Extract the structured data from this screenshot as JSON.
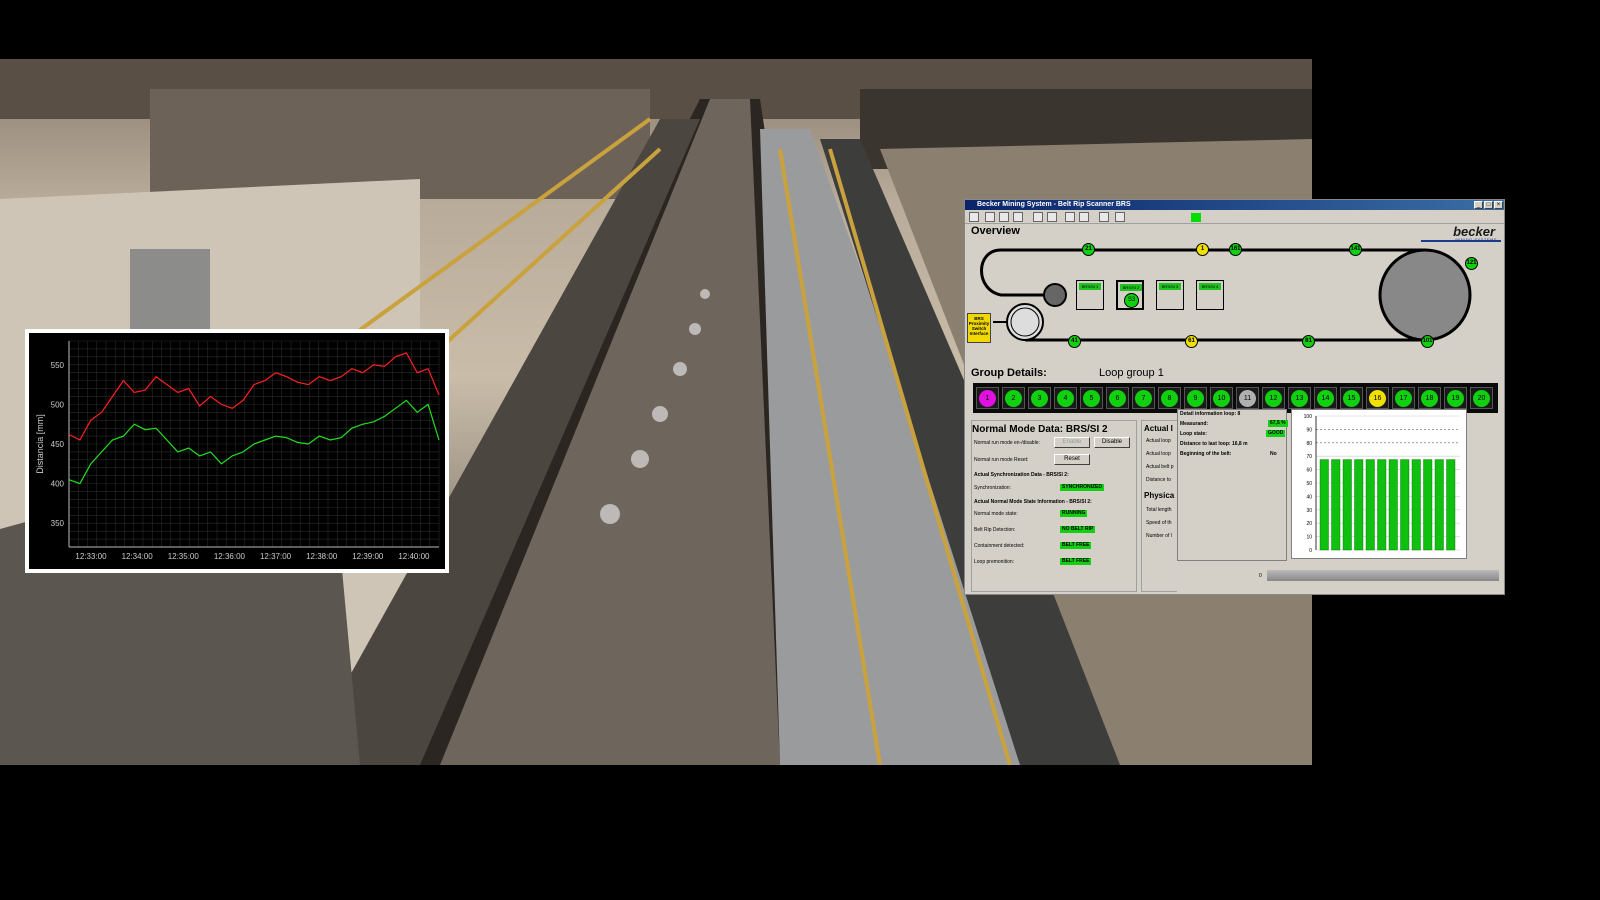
{
  "hmi": {
    "window_title": "Becker Mining System - Belt Rip Scanner BRS",
    "overview_title": "Overview",
    "logo_word": "becker",
    "logo_sub": "MINING SYSTEMS",
    "top_nodes": [
      "21",
      "1",
      "161",
      "141",
      "121"
    ],
    "top_node_colors": [
      "green",
      "yellow",
      "green",
      "green",
      "green"
    ],
    "bottom_nodes": [
      "41",
      "61",
      "81",
      "101"
    ],
    "bottom_node_colors": [
      "green",
      "yellow",
      "green",
      "green"
    ],
    "si_boxes": [
      "BRS/SI 1",
      "BRS/SI 2",
      "BRS/SI 3",
      "BRS/SI 4"
    ],
    "si_active_label": "S3",
    "prox_switch_label": "BRS Proximity Switch Interface",
    "group_details_title": "Group Details:",
    "loop_group_title": "Loop group 1",
    "loops": [
      {
        "n": "1",
        "state": "magenta"
      },
      {
        "n": "2",
        "state": "green"
      },
      {
        "n": "3",
        "state": "green"
      },
      {
        "n": "4",
        "state": "green"
      },
      {
        "n": "5",
        "state": "green"
      },
      {
        "n": "6",
        "state": "green"
      },
      {
        "n": "7",
        "state": "green"
      },
      {
        "n": "8",
        "state": "green"
      },
      {
        "n": "9",
        "state": "green"
      },
      {
        "n": "10",
        "state": "green"
      },
      {
        "n": "11",
        "state": "gray"
      },
      {
        "n": "12",
        "state": "green"
      },
      {
        "n": "13",
        "state": "green"
      },
      {
        "n": "14",
        "state": "green"
      },
      {
        "n": "15",
        "state": "green"
      },
      {
        "n": "16",
        "state": "yellow"
      },
      {
        "n": "17",
        "state": "green"
      },
      {
        "n": "18",
        "state": "green"
      },
      {
        "n": "19",
        "state": "green"
      },
      {
        "n": "20",
        "state": "green"
      }
    ],
    "normal_mode": {
      "title": "Normal Mode Data: BRS/SI 2",
      "run_mode_label": "Normal run mode en-/disable:",
      "enable_btn": "Enable",
      "disable_btn": "Disable",
      "reset_label": "Normal run mode Reset:",
      "reset_btn": "Reset",
      "sync_header": "Actual Synchronization Data - BRS/SI 2:",
      "sync_label": "Synchronization:",
      "sync_value": "SYNCHRONIZED",
      "state_header": "Actual Normal Mode State Information - BRS/SI 2:",
      "rows": [
        {
          "label": "Normal mode state:",
          "value": "RUNNING"
        },
        {
          "label": "Belt Rip Detection:",
          "value": "NO BELT RIP"
        },
        {
          "label": "Containment detected:",
          "value": "BELT FREE"
        },
        {
          "label": "Loop premonition:",
          "value": "BELT FREE"
        }
      ]
    },
    "actual_panel": {
      "title": "Actual I",
      "rows": [
        "Actual loop",
        "Actual loop",
        "Actual belt p",
        "Distance to"
      ],
      "phys_title": "Physica",
      "phys_rows": [
        "Total length",
        "Speed of th",
        "Number of l"
      ]
    },
    "detail": {
      "title": "Detail information loop: 8",
      "measurand_label": "Measurand:",
      "measurand_value": "67,5 %",
      "loop_state_label": "Loop state:",
      "loop_state_value": "GOOD",
      "distance_label": "Distance to last loop: 16,8 m",
      "beginning_label": "Beginning of the belt:",
      "beginning_value": "No"
    },
    "bar_chart": {
      "type": "bar",
      "y_ticks": [
        "100",
        "90",
        "80",
        "70",
        "60",
        "50",
        "40",
        "30",
        "20",
        "10",
        "0"
      ],
      "ylim": [
        0,
        100
      ],
      "values": [
        67.5,
        67.5,
        67.5,
        67.5,
        67.5,
        67.5,
        67.5,
        67.5,
        67.5,
        67.5,
        67.5,
        67.5
      ],
      "color": "#10c010"
    },
    "scroll_zero": "0"
  },
  "chart_data": {
    "type": "line",
    "ylabel": "Distancia [mm]",
    "xlabel": "",
    "x_ticks": [
      "12:33:00",
      "12:34:00",
      "12:35:00",
      "12:36:00",
      "12:37:00",
      "12:38:00",
      "12:39:00",
      "12:40:00"
    ],
    "y_ticks": [
      550,
      500,
      450,
      400,
      350
    ],
    "ylim": [
      320,
      580
    ],
    "series": [
      {
        "color": "#ff2020",
        "values": [
          462,
          455,
          480,
          490,
          510,
          530,
          515,
          518,
          535,
          525,
          515,
          520,
          498,
          510,
          500,
          495,
          505,
          525,
          530,
          540,
          535,
          528,
          525,
          535,
          530,
          535,
          545,
          540,
          550,
          548,
          560,
          565,
          540,
          545,
          512
        ]
      },
      {
        "color": "#20e020",
        "values": [
          405,
          400,
          425,
          440,
          455,
          460,
          475,
          468,
          470,
          455,
          440,
          445,
          435,
          440,
          425,
          435,
          440,
          450,
          455,
          460,
          458,
          452,
          450,
          460,
          455,
          458,
          470,
          475,
          478,
          485,
          495,
          505,
          490,
          500,
          455
        ]
      }
    ],
    "grid": true
  }
}
